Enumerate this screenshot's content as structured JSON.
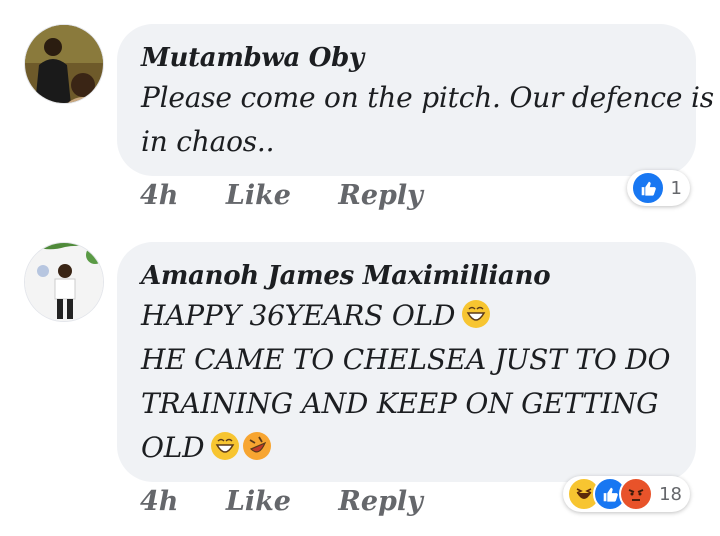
{
  "comments": [
    {
      "author": "Mutambwa Oby",
      "lines": [
        "Please come on the pitch. Our defence is",
        "in chaos.."
      ],
      "time": "4h",
      "like_label": "Like",
      "reply_label": "Reply",
      "reaction_icons": [
        "like-icon"
      ],
      "reaction_count": "1"
    },
    {
      "author": "Amanoh James Maximilliano",
      "lines": [
        "HAPPY 36YEARS OLD",
        "HE CAME TO CHELSEA JUST TO DO",
        "TRAINING AND KEEP ON GETTING",
        "OLD"
      ],
      "time": "4h",
      "like_label": "Like",
      "reply_label": "Reply",
      "reaction_icons": [
        "haha-icon",
        "like-icon",
        "angry-icon"
      ],
      "reaction_count": "18"
    }
  ],
  "colors": {
    "bubble": "#f0f2f5",
    "like_blue": "#1877f2",
    "meta_gray": "#65676b",
    "angry_red": "#e0245e",
    "haha_yellow": "#f7b125"
  }
}
